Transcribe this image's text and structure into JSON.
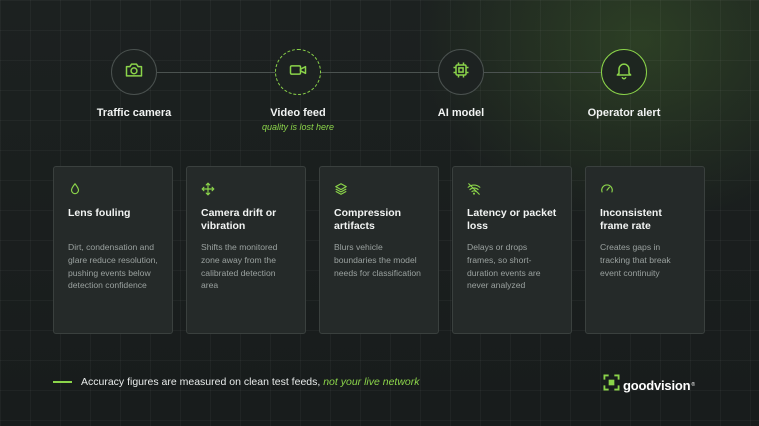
{
  "pipeline": {
    "stages": [
      {
        "label": "Traffic camera",
        "sublabel": "",
        "icon": "camera-icon"
      },
      {
        "label": "Video feed",
        "sublabel": "quality is lost here",
        "icon": "video-camera-icon"
      },
      {
        "label": "AI model",
        "sublabel": "",
        "icon": "chip-icon"
      },
      {
        "label": "Operator alert",
        "sublabel": "",
        "icon": "bell-icon"
      }
    ]
  },
  "cards": [
    {
      "title": "Lens fouling",
      "description": "Dirt, condensation and glare reduce resolution, pushing events below detection confidence",
      "icon": "droplet-icon"
    },
    {
      "title": "Camera drift or vibration",
      "description": "Shifts the monitored zone away from the calibrated detection area",
      "icon": "move-arrows-icon"
    },
    {
      "title": "Compression artifacts",
      "description": "Blurs vehicle boundaries the model needs for classification",
      "icon": "layers-icon"
    },
    {
      "title": "Latency or packet loss",
      "description": "Delays or drops frames, so short-duration events are never analyzed",
      "icon": "wifi-off-icon"
    },
    {
      "title": "Inconsistent frame rate",
      "description": "Creates gaps in tracking that break event continuity",
      "icon": "gauge-icon"
    }
  ],
  "footer": {
    "note": "Accuracy figures are measured on clean test feeds,",
    "note_highlight": "not your live network"
  },
  "logo": {
    "text_part1": "good",
    "text_part2": "vision",
    "registered": "®"
  },
  "colors": {
    "accent": "#8bd44a",
    "background": "#1a1e1e",
    "card": "#252a29",
    "muted_text": "#9aa19f"
  }
}
